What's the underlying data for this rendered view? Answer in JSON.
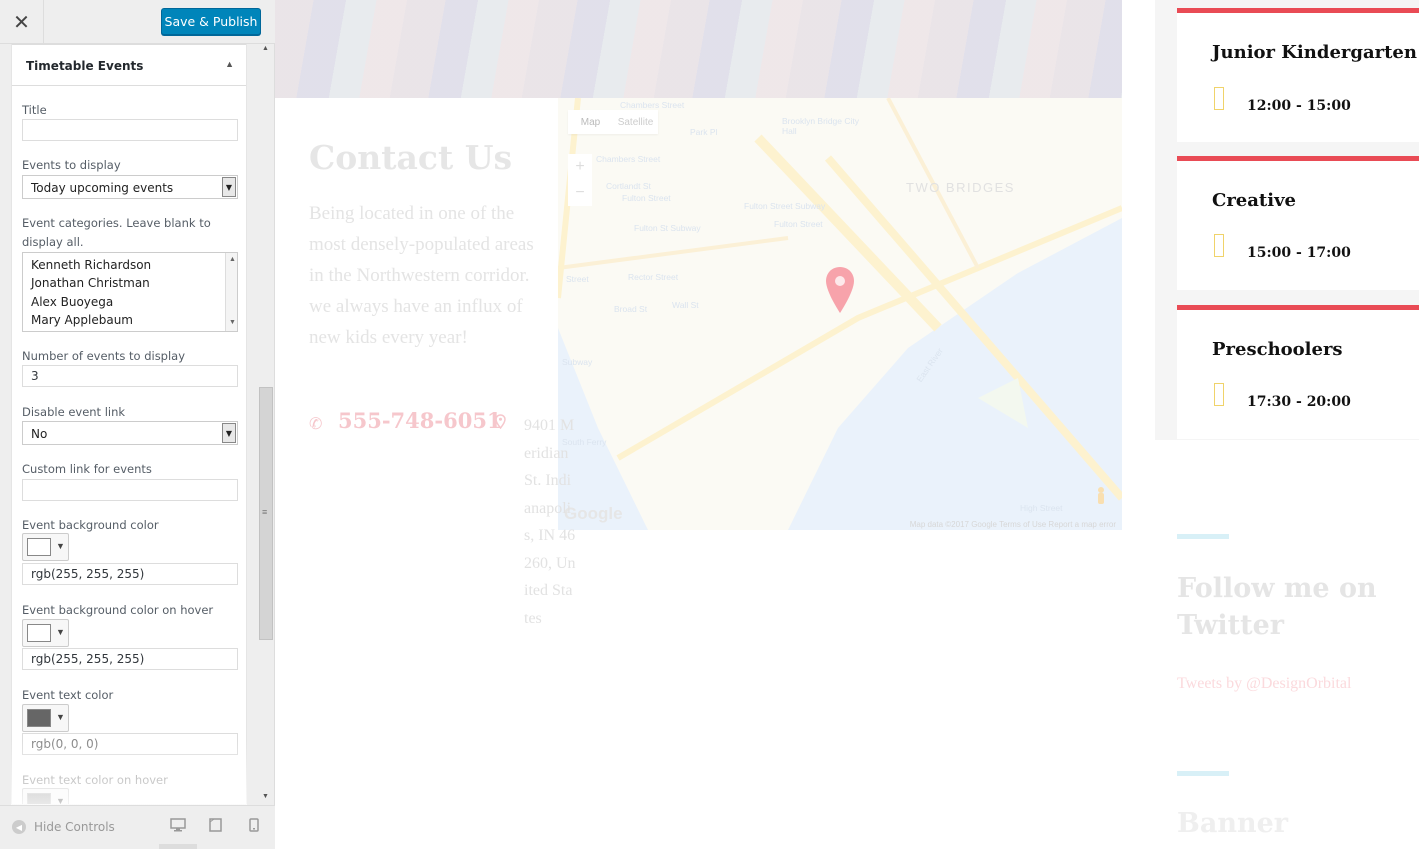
{
  "customizer": {
    "close_label": "✕",
    "save_label": "Save & Publish",
    "section_title": "Timetable Events",
    "section_arrow": "▲",
    "fields": {
      "title": {
        "label": "Title",
        "value": ""
      },
      "events_to_display": {
        "label": "Events to display",
        "value": "Today upcoming events"
      },
      "event_categories": {
        "label": "Event categories. Leave blank to display all.",
        "options": [
          "Kenneth Richardson",
          "Jonathan Christman",
          "Alex Buoyega",
          "Mary Applebaum"
        ]
      },
      "number_of_events": {
        "label": "Number of events to display",
        "value": "3"
      },
      "disable_event_link": {
        "label": "Disable event link",
        "value": "No"
      },
      "custom_link": {
        "label": "Custom link for events",
        "value": ""
      },
      "bg_color": {
        "label": "Event background color",
        "value": "rgb(255, 255, 255)",
        "swatch": "#ffffff"
      },
      "bg_color_hover": {
        "label": "Event background color on hover",
        "value": "rgb(255, 255, 255)",
        "swatch": "#ffffff"
      },
      "text_color": {
        "label": "Event text color",
        "value": "rgb(0, 0, 0)",
        "swatch": "#666666"
      },
      "text_color_hover": {
        "label": "Event text color on hover",
        "swatch": "#aaaaaa"
      }
    },
    "footer": {
      "hide_controls_label": "Hide Controls"
    },
    "icons": [
      "close-icon",
      "caret-up-icon",
      "select-arrow-icon",
      "desktop-icon",
      "tablet-icon",
      "mobile-icon",
      "collapse-icon"
    ]
  },
  "preview": {
    "contact": {
      "title": "Contact Us",
      "text": "Being located in one of the most densely-populated areas in the Northwestern corridor. we always have an influx of new kids every year!",
      "phone": "555-748-6051",
      "address": "9401 Meridian St. Indianapolis, IN 46260, United States"
    },
    "map": {
      "type_map": "Map",
      "type_satellite": "Satellite",
      "zoom_in": "+",
      "zoom_out": "−",
      "area_label": "TWO BRIDGES",
      "google_logo": "Google",
      "credits": "Map data ©2017 Google   Terms of Use   Report a map error",
      "streets": [
        "Chambers Street",
        "Park Pl",
        "Brooklyn Bridge City Hall",
        "Chambers Street",
        "Cortlandt St",
        "Fulton Street",
        "Fulton Street Subway",
        "Fulton Street",
        "Fulton St Subway",
        "Rector Street",
        "Street",
        "Broad St",
        "Wall St",
        "Subway",
        "South Ferry",
        "East River",
        "High Street"
      ]
    },
    "events": [
      {
        "title": "Junior Kindergarten",
        "time": "12:00 - 15:00"
      },
      {
        "title": "Creative",
        "time": "15:00 - 17:00"
      },
      {
        "title": "Preschoolers",
        "time": "17:30 - 20:00"
      }
    ],
    "twitter": {
      "title": "Follow me on Twitter",
      "link": "Tweets by @DesignOrbital"
    },
    "banner": {
      "title": "Banner"
    },
    "colors": {
      "accent": "#e94b55",
      "button": "#0085ba",
      "highlight": "#f0d36a"
    }
  }
}
